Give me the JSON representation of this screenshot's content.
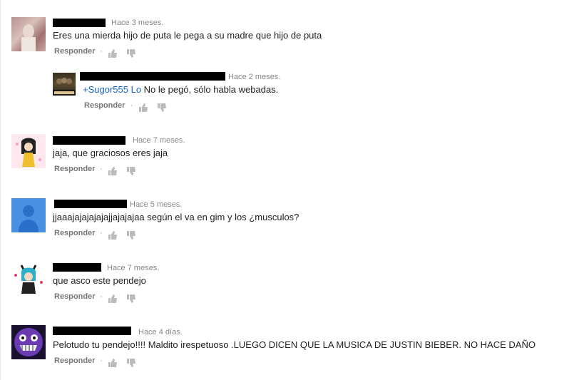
{
  "comments": [
    {
      "time": "Hace 3 meses.",
      "text": "Eres una mierda hijo de puta le pega a su madre que hijo de puta",
      "reply": "Responder",
      "avatar_icon": "user-photo-avatar"
    },
    {
      "time": "Hace 2 meses.",
      "mention": "+Sugor555 Lo",
      "text": " No le pegó, sólo habla webadas.",
      "reply": "Responder",
      "avatar_icon": "group-photo-avatar"
    },
    {
      "time": "Hace 7 meses.",
      "text": "jaja, que graciosos eres jaja",
      "reply": "Responder",
      "avatar_icon": "anime-girl-avatar"
    },
    {
      "time": "Hace 5 meses.",
      "text": "jjaaajajajajajajjajajajaa según el va en gim y los ¿musculos?",
      "reply": "Responder",
      "avatar_icon": "default-user-avatar"
    },
    {
      "time": "Hace 7 meses.",
      "text": "que asco este pendejo",
      "reply": "Responder",
      "avatar_icon": "bulma-avatar"
    },
    {
      "time": "Hace 4 días.",
      "text": "Pelotudo tu pendejo!!!! Maldito irespetuoso .LUEGO DICEN QUE LA MUSICA DE JUSTIN BIEBER. NO HACE DAÑO",
      "reply": "Responder",
      "avatar_icon": "purple-monster-avatar"
    }
  ],
  "separator": "·",
  "colors": {
    "link": "#1a66c4",
    "meta": "#888888",
    "default_avatar_bg": "#4a90e2"
  }
}
